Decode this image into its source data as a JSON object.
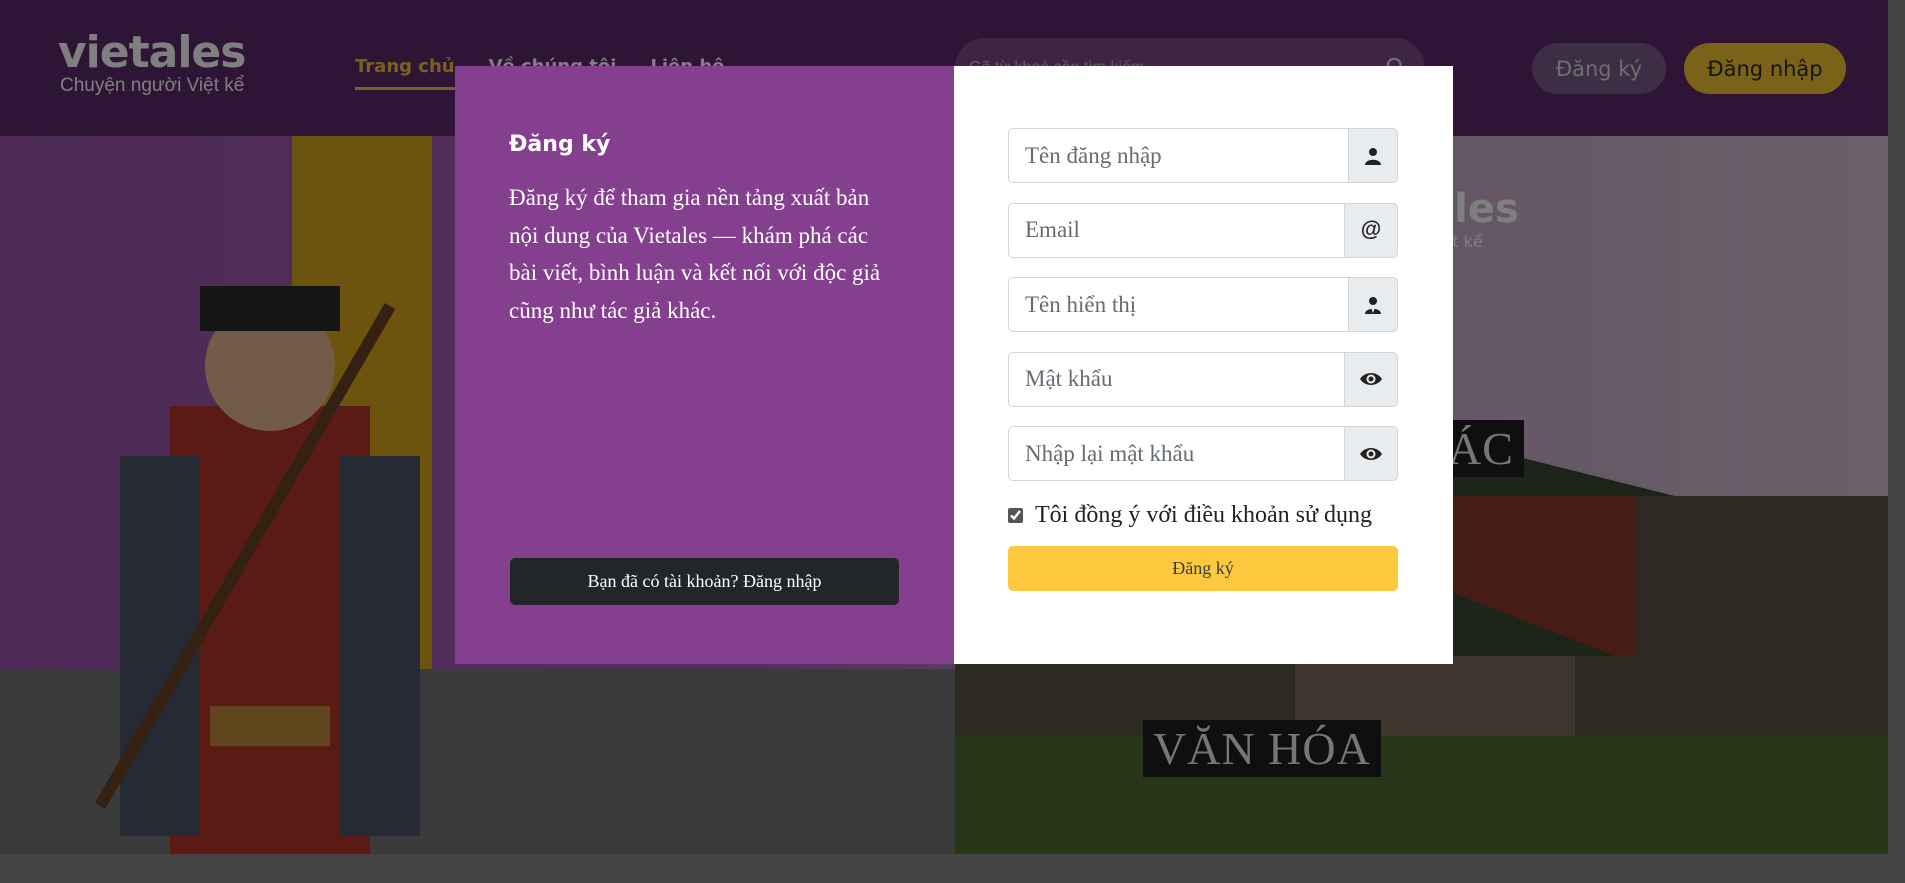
{
  "header": {
    "logo_main": "vietales",
    "logo_sub": "Chuyện người Việt kể",
    "nav": [
      {
        "label": "Trang chủ",
        "active": true
      },
      {
        "label": "Về chúng tôi",
        "active": false
      },
      {
        "label": "Liên hệ",
        "active": false
      }
    ],
    "search_placeholder": "Gõ từ khoá cần tìm kiếm",
    "register_label": "Đăng ký",
    "login_label": "Đăng nhập"
  },
  "hero": {
    "labels": [
      "SÁNG TÁC",
      "VĂN HÓA"
    ],
    "ghost_logo": "tales",
    "ghost_sub": "ời Việt kể"
  },
  "modal": {
    "title": "Đăng ký",
    "description": "Đăng ký để tham gia nền tảng xuất bản nội dung của Vietales — khám phá các bài viết, bình luận và kết nối với độc giả cũng như tác giả khác.",
    "have_account_button": "Bạn đã có tài khoản? Đăng nhập",
    "fields": {
      "username_placeholder": "Tên đăng nhập",
      "email_placeholder": "Email",
      "display_name_placeholder": "Tên hiển thị",
      "password_placeholder": "Mật khẩu",
      "confirm_password_placeholder": "Nhập lại mật khẩu"
    },
    "email_addon": "@",
    "terms_label": "Tôi đồng ý với điều khoản sử dụng",
    "terms_checked": true,
    "submit_button": "Đăng ký"
  },
  "colors": {
    "header": "#5c2a6b",
    "modal_left": "#843f8f",
    "accent_yellow": "#ffc93f",
    "dark_button": "#232629"
  }
}
